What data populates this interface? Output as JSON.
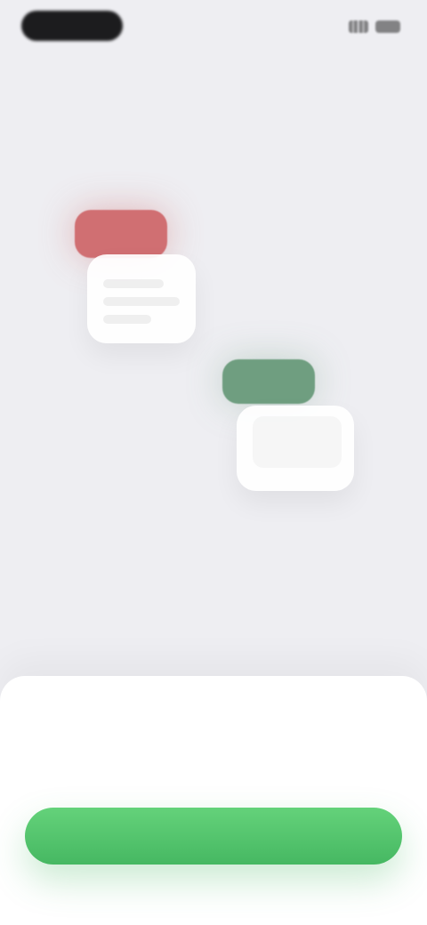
{
  "status_bar": {
    "left_pill": "",
    "right_icons": [
      "signal-icon",
      "battery-icon"
    ]
  },
  "illustration": {
    "badge_red": "",
    "badge_green": ""
  },
  "sheet": {
    "title": "",
    "description": "",
    "primary_button": ""
  },
  "colors": {
    "background": "#eeeef2",
    "sheet_background": "#ffffff",
    "accent_green": "#4fc36a",
    "badge_red": "#d06f72",
    "badge_green": "#6f9e80"
  }
}
